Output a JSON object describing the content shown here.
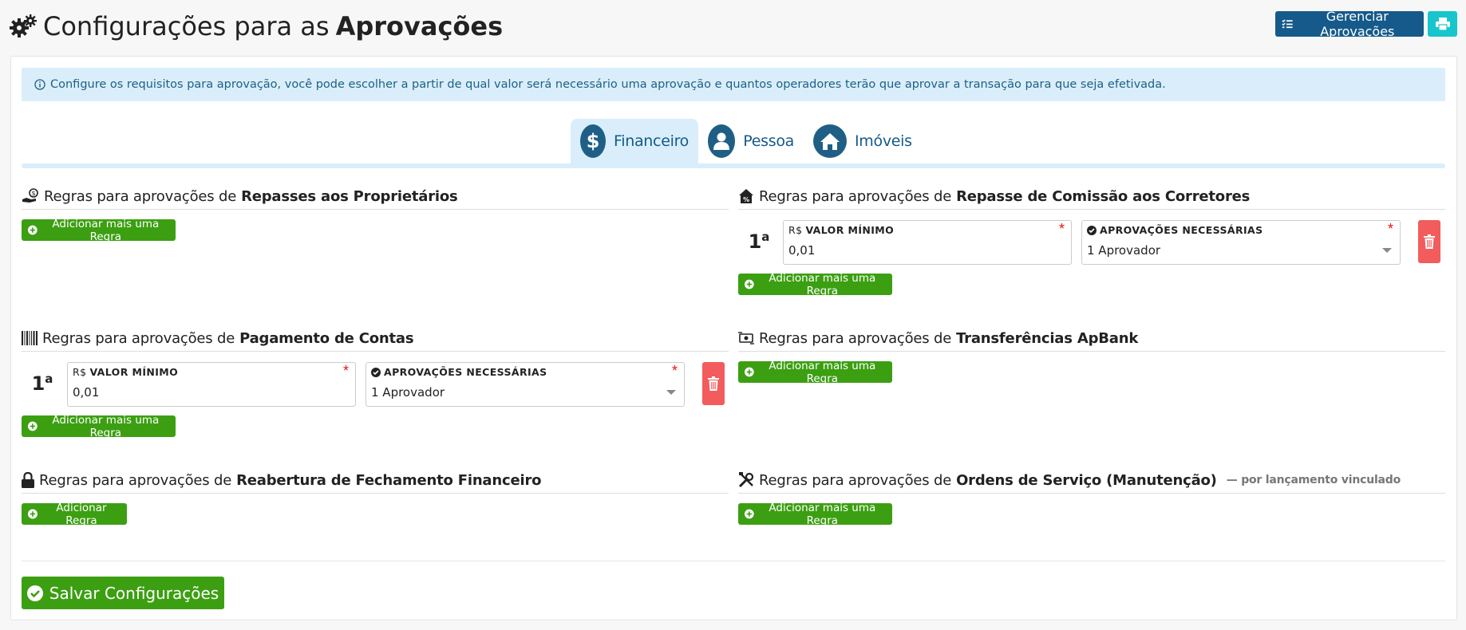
{
  "header": {
    "title_prefix": "Configurações para as",
    "title_bold": "Aprovações",
    "manage_button": "Gerenciar Aprovações"
  },
  "alert": {
    "text": "Configure os requisitos para aprovação, você pode escolher a partir de qual valor será necessário uma aprovação e quantos operadores terão que aprovar a transação para que seja efetivada."
  },
  "tabs": [
    {
      "label": "Financeiro",
      "icon": "dollar-icon",
      "active": true
    },
    {
      "label": "Pessoa",
      "icon": "user-icon",
      "active": false
    },
    {
      "label": "Imóveis",
      "icon": "home-icon",
      "active": false
    }
  ],
  "common": {
    "rules_prefix": "Regras para aprovações de",
    "add_more_rule": "Adicionar mais uma Regra",
    "add_rule": "Adicionar Regra",
    "min_value_label": "VALOR MÍNIMO",
    "currency_symbol": "R$",
    "approvals_label": "APROVAÇÕES NECESSÁRIAS",
    "required_mark": "*"
  },
  "sections": {
    "repasses": {
      "title": "Repasses aos Proprietários"
    },
    "comissao": {
      "title": "Repasse de Comissão aos Corretores",
      "rules": [
        {
          "ord": "1",
          "ord_suffix": "a",
          "min_value": "0,01",
          "approvals": "1 Aprovador"
        }
      ]
    },
    "pagamento": {
      "title": "Pagamento de Contas",
      "rules": [
        {
          "ord": "1",
          "ord_suffix": "a",
          "min_value": "0,01",
          "approvals": "1 Aprovador"
        }
      ]
    },
    "transferencias": {
      "title": "Transferências ApBank"
    },
    "reabertura": {
      "title": "Reabertura de Fechamento Financeiro"
    },
    "ordens": {
      "title": "Ordens de Serviço (Manutenção)",
      "note": "— por lançamento vinculado"
    }
  },
  "footer": {
    "save_button": "Salvar Configurações"
  },
  "colors": {
    "primary": "#155a8a",
    "info_bg": "#d9eefa",
    "success": "#3c9f12",
    "danger": "#f25c5c",
    "print": "#17c6cc"
  }
}
